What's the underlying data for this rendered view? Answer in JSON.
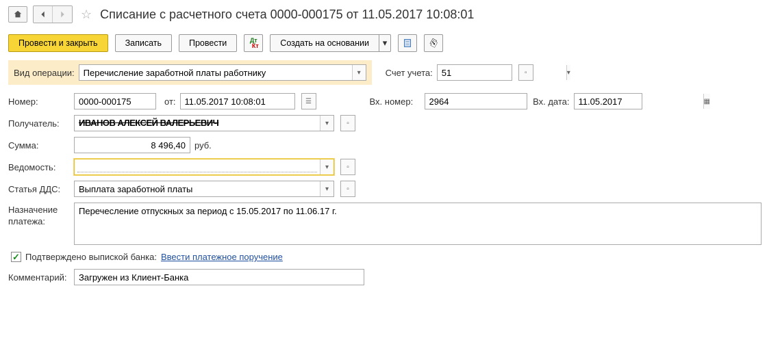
{
  "header": {
    "title": "Списание с расчетного счета 0000-000175 от 11.05.2017 10:08:01"
  },
  "toolbar": {
    "post_close": "Провести и закрыть",
    "save": "Записать",
    "post": "Провести",
    "create_based": "Создать на основании"
  },
  "operation": {
    "label": "Вид операции:",
    "value": "Перечисление заработной платы работнику"
  },
  "account": {
    "label": "Счет учета:",
    "value": "51"
  },
  "number": {
    "label": "Номер:",
    "value": "0000-000175"
  },
  "date": {
    "label": "от:",
    "value": "11.05.2017 10:08:01"
  },
  "in_number": {
    "label": "Вх. номер:",
    "value": "2964"
  },
  "in_date": {
    "label": "Вх. дата:",
    "value": "11.05.2017"
  },
  "recipient": {
    "label": "Получатель:",
    "value_obscured": "████████████████████"
  },
  "sum": {
    "label": "Сумма:",
    "value": "8 496,40",
    "currency": "руб."
  },
  "vedomost": {
    "label": "Ведомость:",
    "value": ""
  },
  "dds": {
    "label": "Статья ДДС:",
    "value": "Выплата заработной платы"
  },
  "purpose": {
    "label1": "Назначение",
    "label2": "платежа:",
    "value": "Перечесление отпускных за период с 15.05.2017 по 11.06.17 г."
  },
  "confirmed": {
    "label": "Подтверждено выпиской банка:",
    "link": "Ввести платежное поручение"
  },
  "comment": {
    "label": "Комментарий:",
    "value": "Загружен из Клиент-Банка"
  }
}
